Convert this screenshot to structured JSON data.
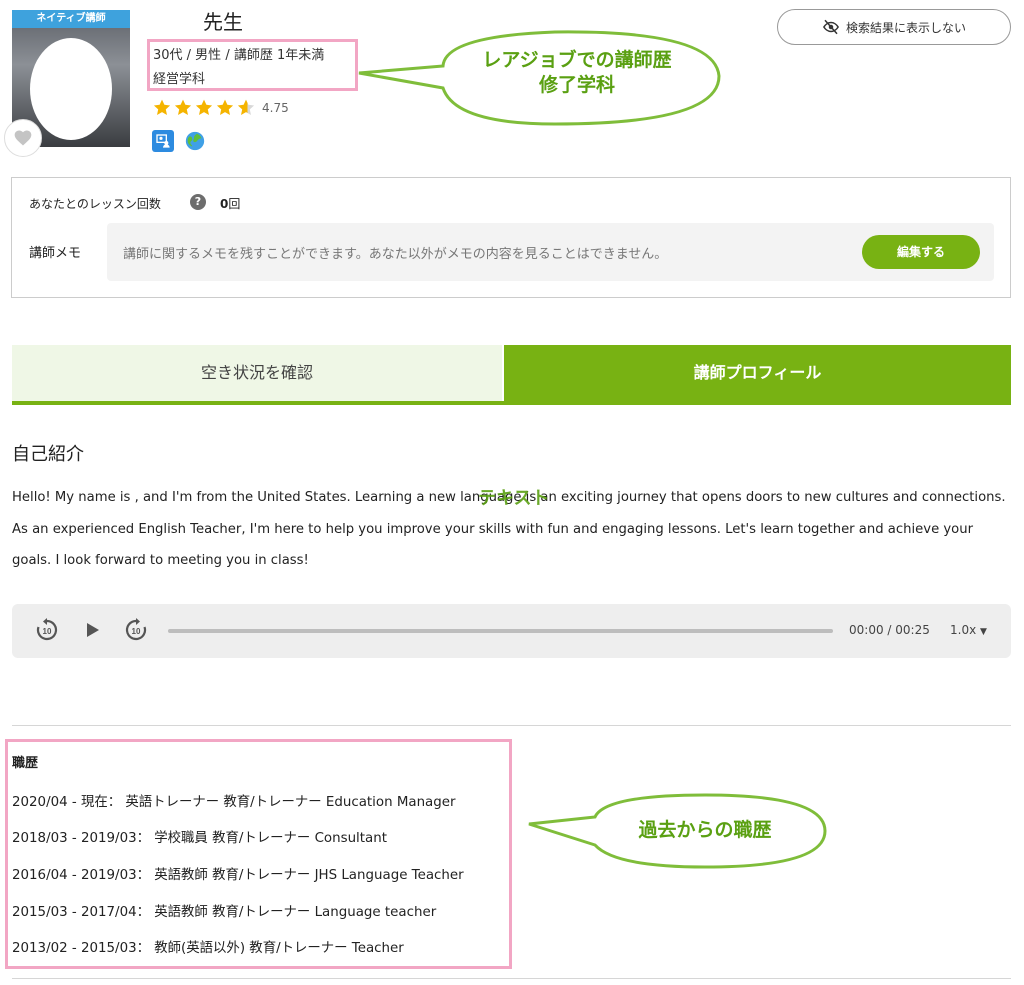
{
  "profile": {
    "native_badge": "ネイティブ講師",
    "name": "先生",
    "meta_line1": "30代 / 男性 / 講師歴 1年未満",
    "meta_line2": "経営学科",
    "rating": "4.75",
    "rating_value": 4.75,
    "hide_button_label": "検索結果に表示しない"
  },
  "annotations": {
    "career_bubble_line1": "レアジョブでの講師歴",
    "career_bubble_line2": "修了学科",
    "text_stamp": "テキスト",
    "history_bubble": "過去からの職歴",
    "color": "#5aa012"
  },
  "memo": {
    "lesson_count_label": "あなたとのレッスン回数",
    "help": "?",
    "lesson_count_value": "0",
    "lesson_count_unit": "回",
    "memo_label": "講師メモ",
    "memo_placeholder": "講師に関するメモを残すことができます。あなた以外がメモの内容を見ることはできません。",
    "edit_button": "編集する"
  },
  "tabs": {
    "availability": "空き状況を確認",
    "profile": "講師プロフィール",
    "active_color": "#78b213"
  },
  "intro": {
    "title": "自己紹介",
    "text": "Hello! My name is        , and I'm from the United States. Learning a new language is an exciting journey that opens doors to new cultures and connections. As an experienced English Teacher, I'm here to help you improve your skills with fun and engaging lessons. Let's learn together and achieve your goals. I look forward to meeting you in class!"
  },
  "audio": {
    "time": "00:00 / 00:25",
    "speed": "1.0x",
    "rewind_icon": "rewind-10-icon",
    "forward_icon": "forward-10-icon"
  },
  "career": {
    "title": "職歴",
    "rows": [
      "2020/04 - 現在： 英語トレーナー 教育/トレーナー Education Manager",
      "2018/03 - 2019/03： 学校職員 教育/トレーナー Consultant",
      "2016/04 - 2019/03： 英語教師 教育/トレーナー JHS Language Teacher",
      "2015/03 - 2017/04： 英語教師 教育/トレーナー Language teacher",
      "2013/02 - 2015/03： 教師(英語以外) 教育/トレーナー Teacher"
    ]
  }
}
